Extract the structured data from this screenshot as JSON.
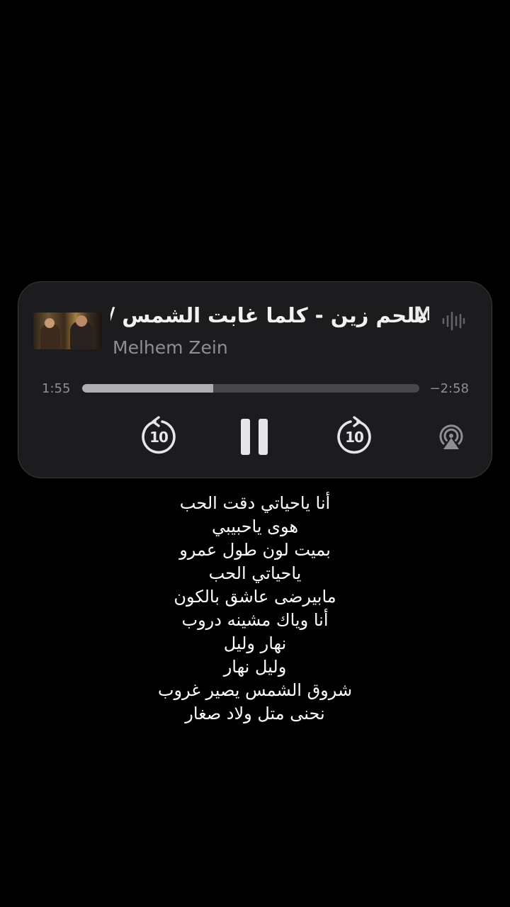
{
  "player": {
    "title": "ملحم زين - كلما غابت الشمس /",
    "title_overflow_char": "M",
    "artist": "Melhem Zein",
    "elapsed": "1:55",
    "remaining": "−2:58",
    "progress_fraction": 0.388,
    "skip_back_seconds": "10",
    "skip_forward_seconds": "10",
    "icons": {
      "waveform": "waveform-icon",
      "skip_back": "gobackward-10-icon",
      "pause": "pause-icon",
      "skip_forward": "goforward-10-icon",
      "airplay": "airplay-audio-icon"
    },
    "colors": {
      "card_bg": "#1c1c1e",
      "progress_fill": "#aeaeb2",
      "progress_track": "#48484a",
      "secondary_text": "#8e8e93"
    }
  },
  "lyrics": [
    "أنا ياحياتي دقت الحب",
    "هوى ياحبيبي",
    "بميت لون طول عمرو",
    "ياحياتي الحب",
    "مابيرضى عاشق بالكون",
    "أنا وياك مشينه دروب",
    "نهار وليل",
    "وليل نهار",
    "شروق الشمس يصير غروب",
    "نحنى متل ولاد صغار"
  ]
}
